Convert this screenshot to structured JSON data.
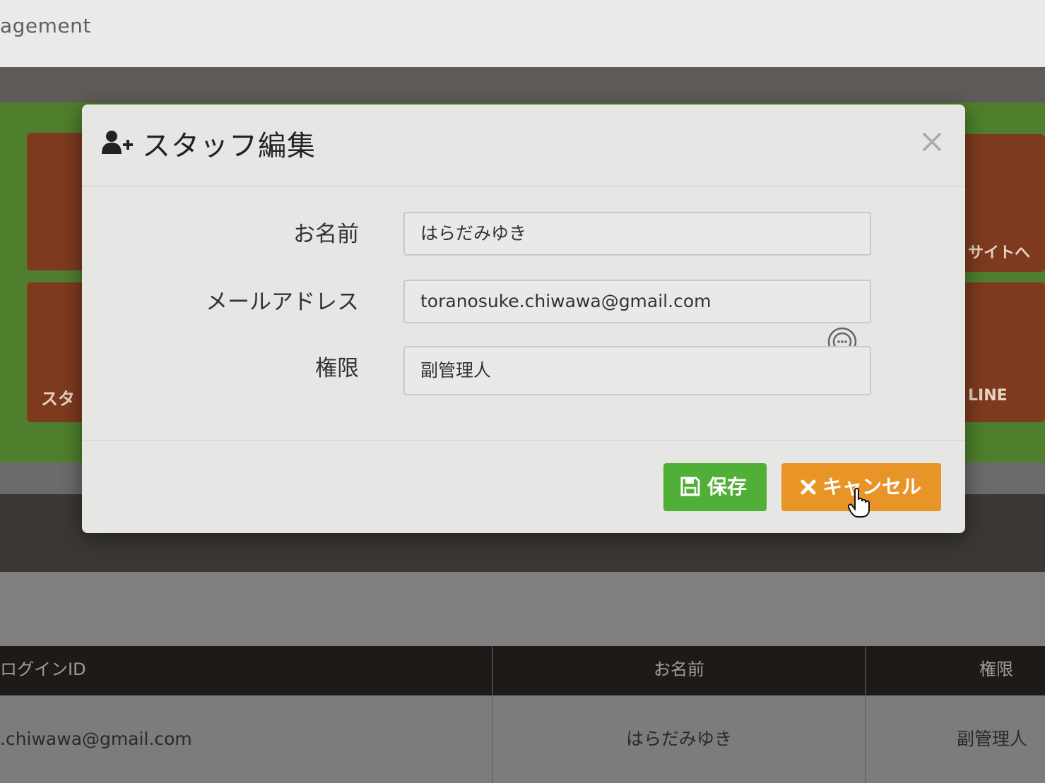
{
  "app": {
    "title_fragment": "agement"
  },
  "background": {
    "tiles": {
      "bottom_left_label": "スタ",
      "top_right_label": "サイトへ",
      "bottom_right_label": "LINE"
    },
    "table": {
      "headers": [
        "ログインID",
        "お名前",
        "権限"
      ],
      "rows": [
        [
          ".chiwawa@gmail.com",
          "はらだみゆき",
          "副管理人"
        ]
      ]
    }
  },
  "modal": {
    "title": "スタッフ編集",
    "title_icon": "user-plus-icon",
    "close_icon": "close-icon",
    "fields": {
      "name": {
        "label": "お名前",
        "value": "はらだみゆき"
      },
      "email": {
        "label": "メールアドレス",
        "value": "toranosuke.chiwawa@gmail.com"
      },
      "role": {
        "label": "権限",
        "value": "副管理人"
      }
    },
    "buttons": {
      "save": {
        "label": "保存",
        "icon": "floppy-disk-icon",
        "color": "#4faf37"
      },
      "cancel": {
        "label": "キャンセル",
        "icon": "close-icon",
        "color": "#e99427"
      }
    }
  }
}
